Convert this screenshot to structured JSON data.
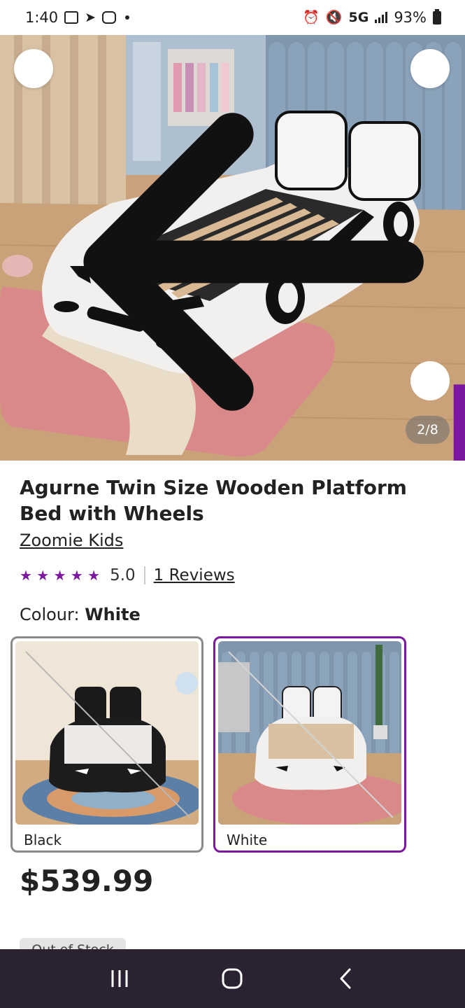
{
  "status_bar": {
    "time": "1:40",
    "network": "5G",
    "battery": "93%"
  },
  "gallery": {
    "counter": "2/8"
  },
  "product": {
    "title": "Agurne Twin Size Wooden Platform Bed with Wheels",
    "brand": "Zoomie Kids",
    "rating_value": "5.0",
    "stars": "★ ★ ★ ★ ★",
    "reviews_label": "1 Reviews",
    "colour_label": "Colour:",
    "colour_value": "White",
    "price": "$539.99",
    "stock_label": "Out of Stock"
  },
  "swatches": [
    {
      "label": "Black"
    },
    {
      "label": "White"
    }
  ],
  "colors": {
    "accent": "#7b189f",
    "nav_bg": "#2a2230"
  },
  "icons": {
    "back": "arrow-left-icon",
    "share": "share-icon",
    "visual_search": "visual-search-icon"
  }
}
